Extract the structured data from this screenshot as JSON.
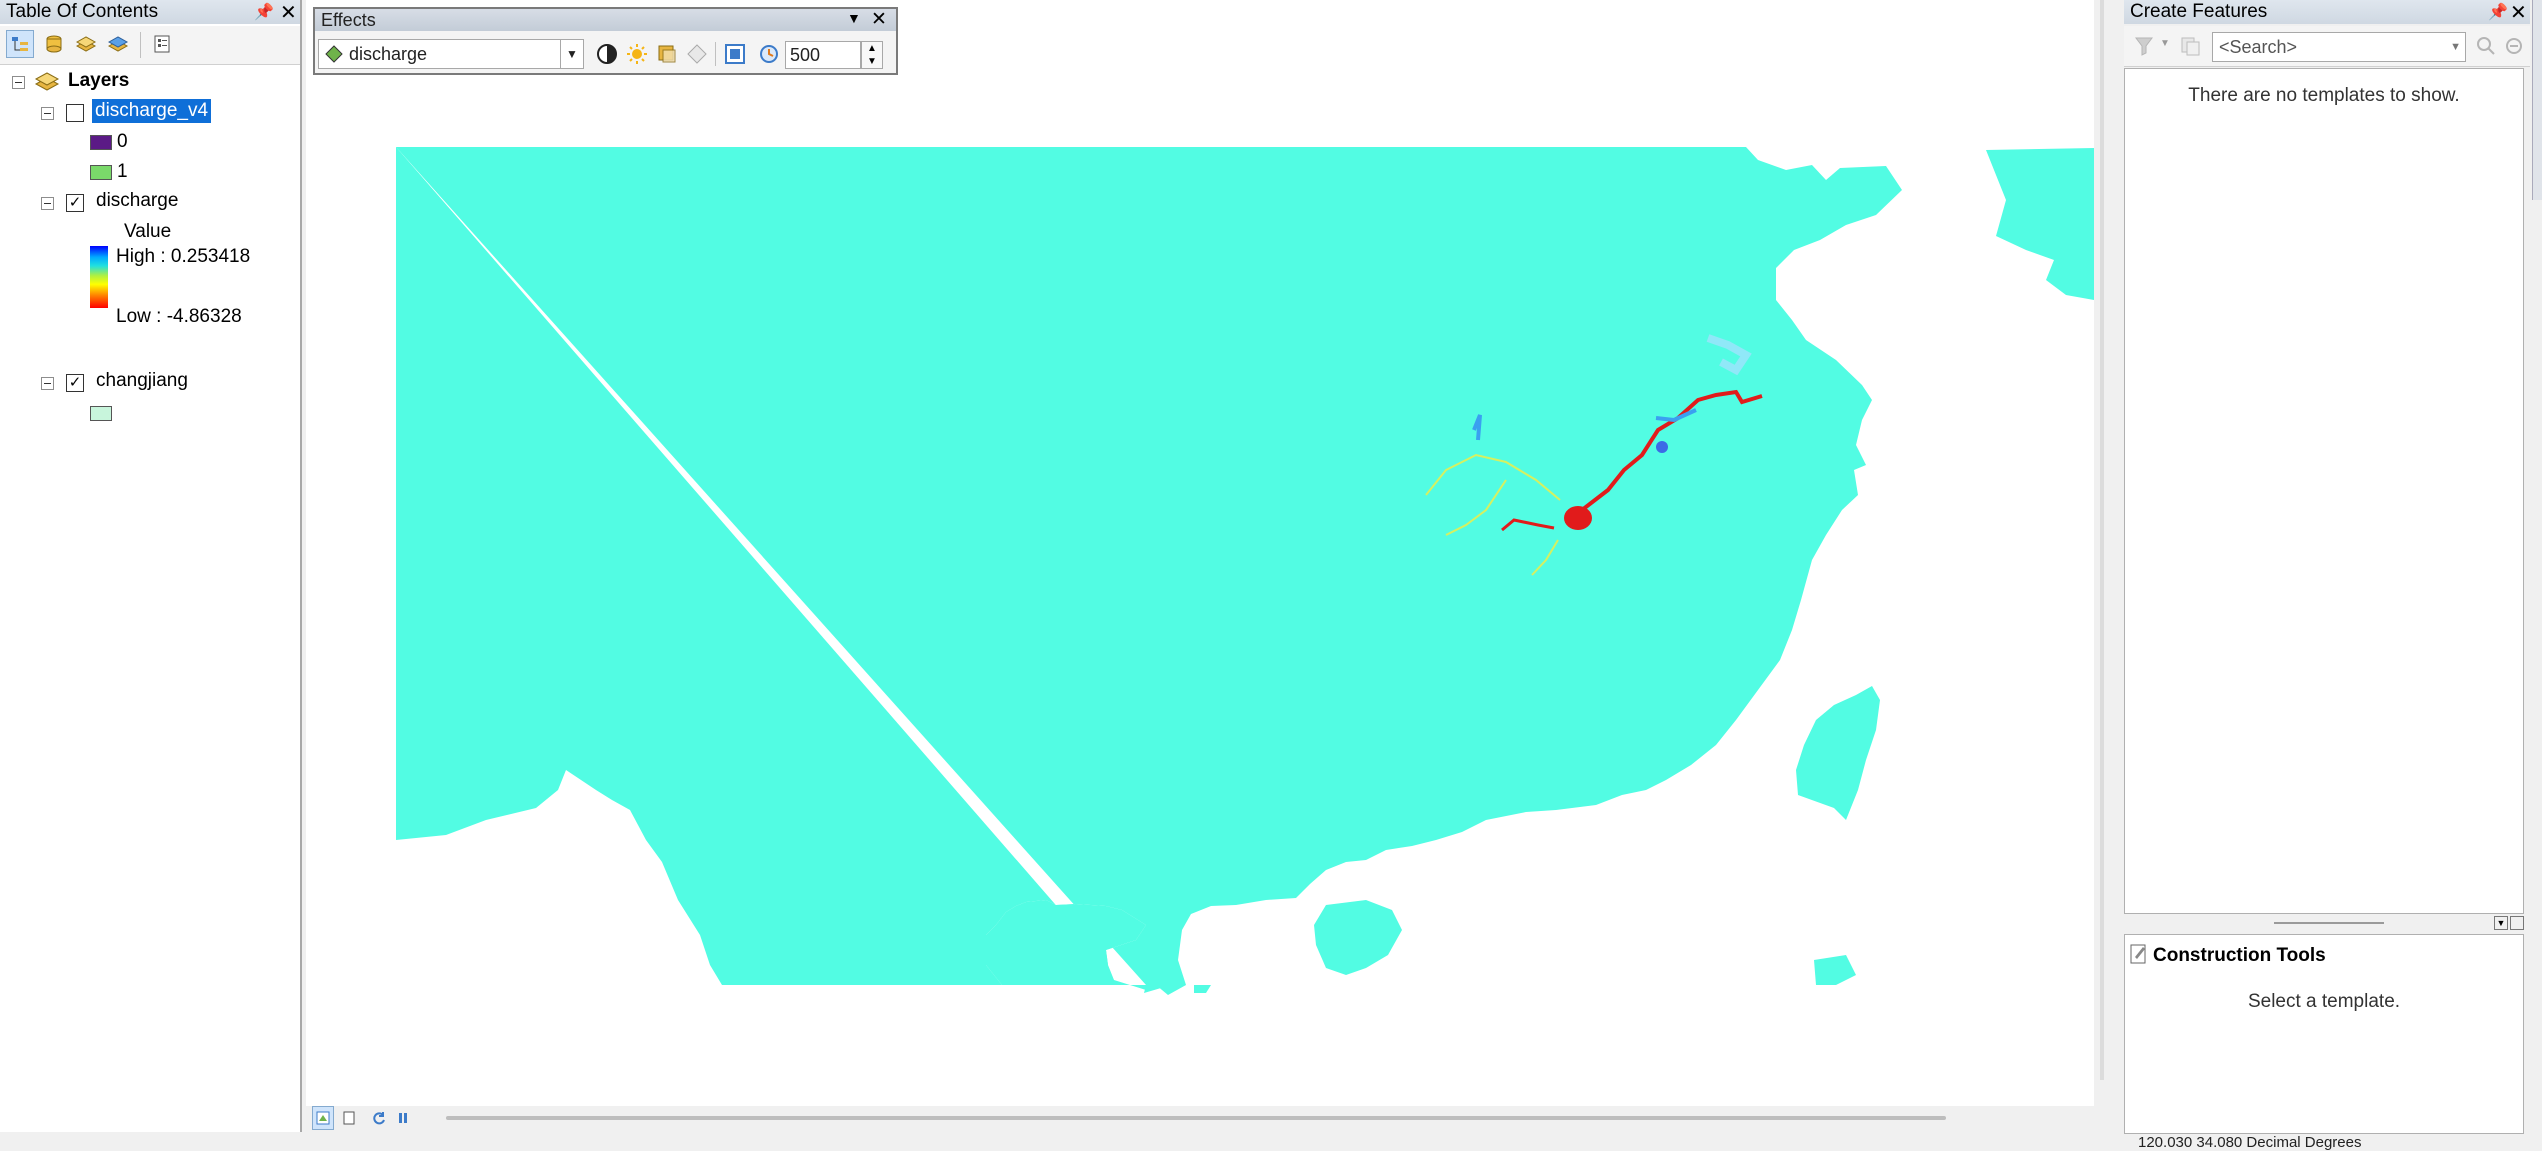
{
  "toc": {
    "title": "Table Of Contents",
    "root_label": "Layers",
    "layers": [
      {
        "name": "discharge_v4",
        "checked": false,
        "selected": true,
        "legend": [
          {
            "label": "0",
            "color": "#5b1a86"
          },
          {
            "label": "1",
            "color": "#7ad96a"
          }
        ]
      },
      {
        "name": "discharge",
        "checked": true,
        "field_label": "Value",
        "high_label": "High : 0.253418",
        "low_label": "Low : -4.86328"
      },
      {
        "name": "changjiang",
        "checked": true,
        "swatch_color": "#c8f5dc"
      }
    ]
  },
  "effects": {
    "title": "Effects",
    "layer_select": "discharge",
    "flicker_rate": "500"
  },
  "create_features": {
    "title": "Create Features",
    "search_placeholder": "<Search>",
    "empty_message": "There are no templates to show.",
    "construction_title": "Construction Tools",
    "construction_message": "Select a template."
  },
  "status": {
    "coordinates": "120.030 34.080 Decimal Degrees"
  },
  "map_colors": {
    "land": "#52fce3",
    "river": "#e11b1b",
    "tributary": "#d6f060",
    "water": "#ffffff"
  }
}
